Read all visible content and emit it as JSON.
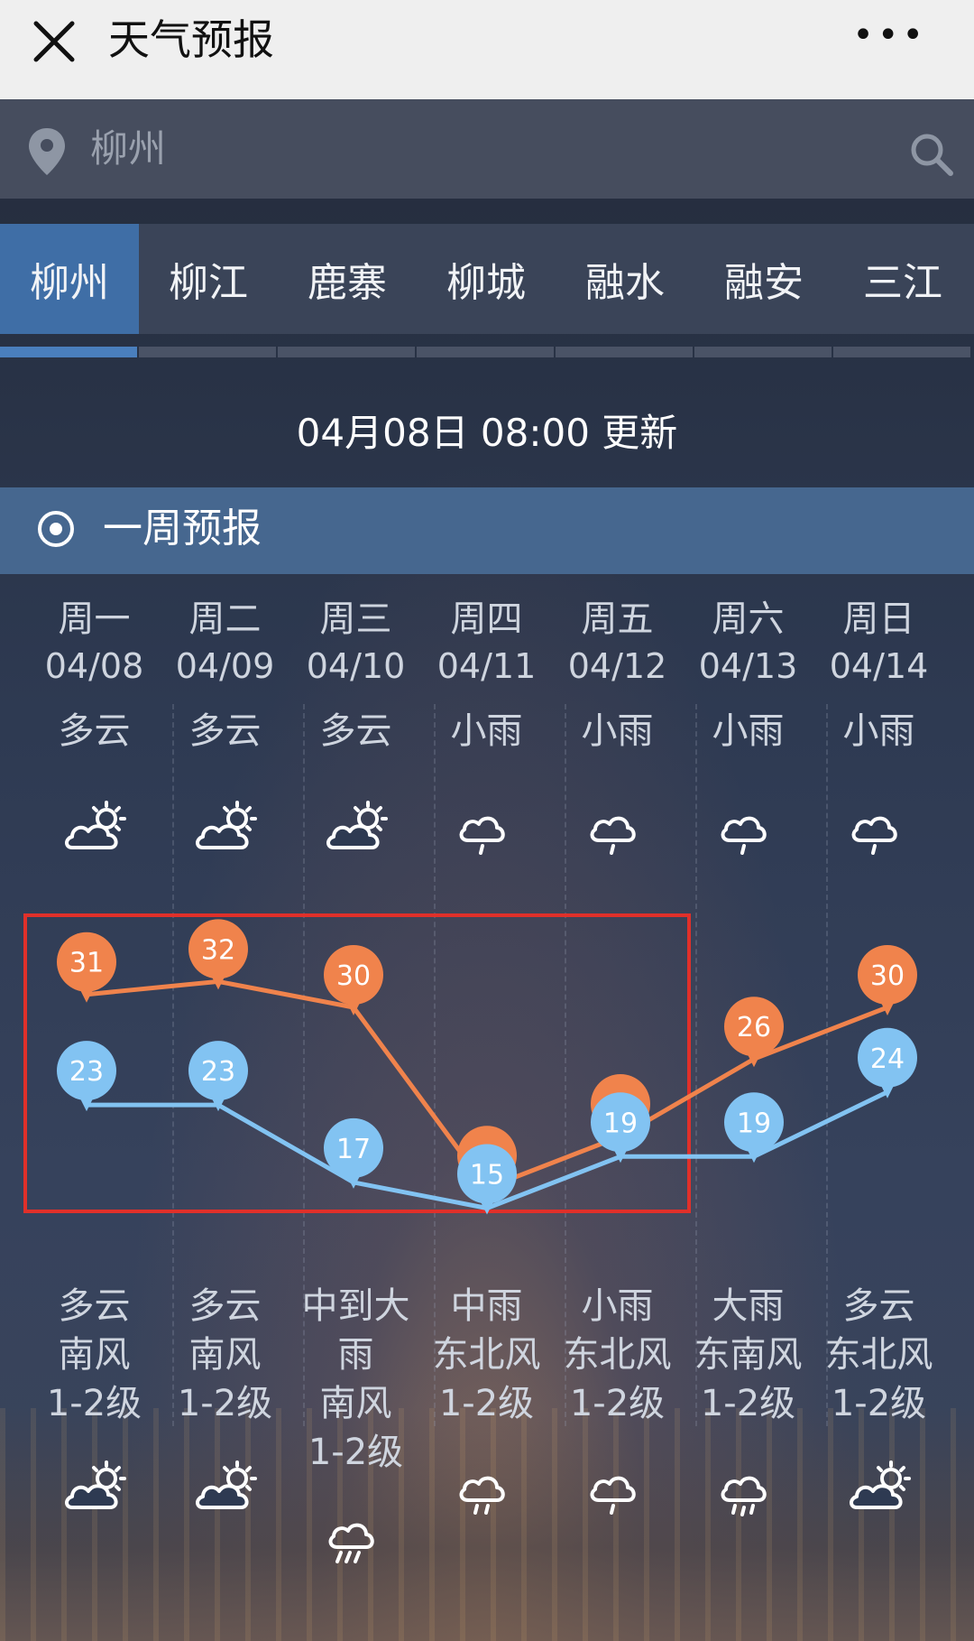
{
  "app": {
    "title": "天气预报",
    "close_icon": "close-icon",
    "more_icon": "more-dots-icon",
    "more_label": "•••"
  },
  "search": {
    "placeholder": "柳州",
    "pin_icon": "location-pin-icon",
    "search_icon": "search-icon"
  },
  "tabs": [
    {
      "label": "柳州",
      "active": true
    },
    {
      "label": "柳江",
      "active": false
    },
    {
      "label": "鹿寨",
      "active": false
    },
    {
      "label": "柳城",
      "active": false
    },
    {
      "label": "融水",
      "active": false
    },
    {
      "label": "融安",
      "active": false
    },
    {
      "label": "三江",
      "active": false
    }
  ],
  "update_text": "04月08日 08:00 更新",
  "section_title": "一周预报",
  "days": [
    {
      "weekday": "周一",
      "date": "04/08",
      "day_cond": "多云",
      "day_icon": "partly-cloudy-icon",
      "night_cond": "多云",
      "wind_dir": "南风",
      "wind_level": "1-2级",
      "night_icon": "partly-cloudy-icon"
    },
    {
      "weekday": "周二",
      "date": "04/09",
      "day_cond": "多云",
      "day_icon": "partly-cloudy-icon",
      "night_cond": "多云",
      "wind_dir": "南风",
      "wind_level": "1-2级",
      "night_icon": "partly-cloudy-icon"
    },
    {
      "weekday": "周三",
      "date": "04/10",
      "day_cond": "多云",
      "day_icon": "partly-cloudy-icon",
      "night_cond_line1": "中到大",
      "night_cond_line2": "雨",
      "wind_dir": "南风",
      "wind_level": "1-2级",
      "night_icon": "heavy-rain-icon"
    },
    {
      "weekday": "周四",
      "date": "04/11",
      "day_cond": "小雨",
      "day_icon": "light-rain-icon",
      "night_cond": "中雨",
      "wind_dir": "东北风",
      "wind_level": "1-2级",
      "night_icon": "moderate-rain-icon"
    },
    {
      "weekday": "周五",
      "date": "04/12",
      "day_cond": "小雨",
      "day_icon": "light-rain-icon",
      "night_cond": "小雨",
      "wind_dir": "东北风",
      "wind_level": "1-2级",
      "night_icon": "light-rain-icon"
    },
    {
      "weekday": "周六",
      "date": "04/13",
      "day_cond": "小雨",
      "day_icon": "light-rain-icon",
      "night_cond": "大雨",
      "wind_dir": "东南风",
      "wind_level": "1-2级",
      "night_icon": "heavy-rain-drops-icon"
    },
    {
      "weekday": "周日",
      "date": "04/14",
      "day_cond": "小雨",
      "day_icon": "light-rain-icon",
      "night_cond": "多云",
      "wind_dir": "东北风",
      "wind_level": "1-2级",
      "night_icon": "partly-cloudy-icon"
    }
  ],
  "chart_data": {
    "type": "line",
    "categories": [
      "04/08",
      "04/09",
      "04/10",
      "04/11",
      "04/12",
      "04/13",
      "04/14"
    ],
    "series": [
      {
        "values": [
          31,
          32,
          30,
          16,
          20,
          26,
          30
        ],
        "color": "#f0834c"
      },
      {
        "values": [
          23,
          23,
          17,
          15,
          19,
          19,
          24
        ],
        "color": "#82c3f2"
      }
    ],
    "labels": {
      "high": [
        "31",
        "32",
        "30",
        "",
        "",
        "26",
        "30"
      ],
      "low": [
        "23",
        "23",
        "17",
        "15",
        "19",
        "19",
        "24"
      ]
    },
    "highlight_color": "#e0302a"
  }
}
